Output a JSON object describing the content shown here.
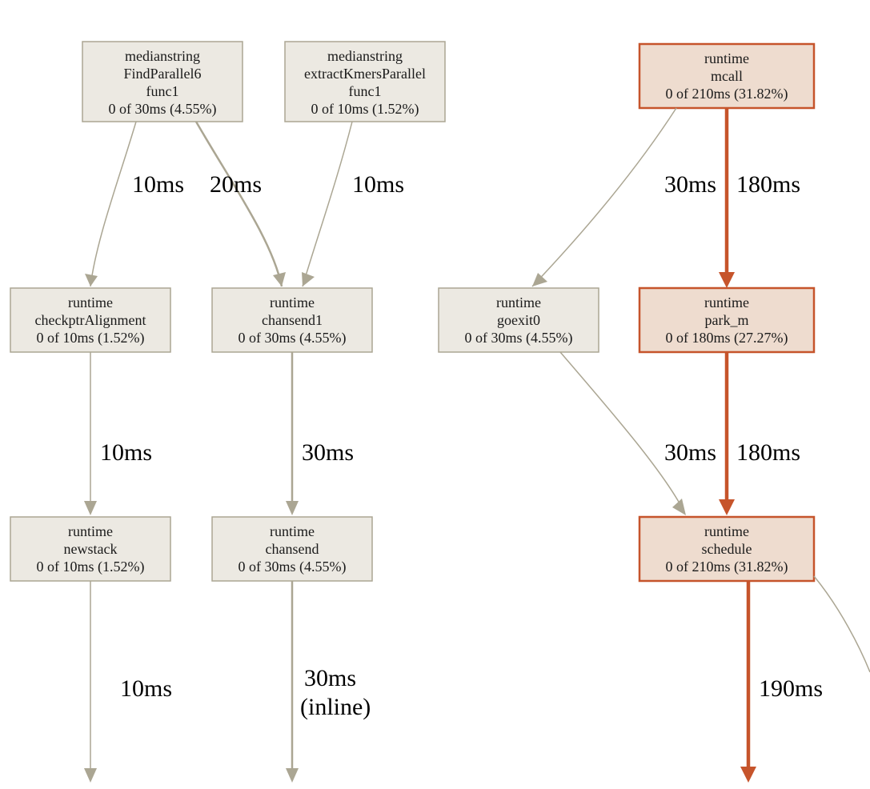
{
  "nodes": {
    "n0": {
      "l1": "medianstring",
      "l2": "FindParallel6",
      "l3": "func1",
      "l4": "0 of 30ms (4.55%)"
    },
    "n1": {
      "l1": "medianstring",
      "l2": "extractKmersParallel",
      "l3": "func1",
      "l4": "0 of 10ms (1.52%)"
    },
    "n2": {
      "l1": "runtime",
      "l2": "mcall",
      "l3": "0 of 210ms (31.82%)"
    },
    "n3": {
      "l1": "runtime",
      "l2": "checkptrAlignment",
      "l3": "0 of 10ms (1.52%)"
    },
    "n4": {
      "l1": "runtime",
      "l2": "chansend1",
      "l3": "0 of 30ms (4.55%)"
    },
    "n5": {
      "l1": "runtime",
      "l2": "goexit0",
      "l3": "0 of 30ms (4.55%)"
    },
    "n6": {
      "l1": "runtime",
      "l2": "park_m",
      "l3": "0 of 180ms (27.27%)"
    },
    "n7": {
      "l1": "runtime",
      "l2": "newstack",
      "l3": "0 of 10ms (1.52%)"
    },
    "n8": {
      "l1": "runtime",
      "l2": "chansend",
      "l3": "0 of 30ms (4.55%)"
    },
    "n9": {
      "l1": "runtime",
      "l2": "schedule",
      "l3": "0 of 210ms (31.82%)"
    }
  },
  "edges": {
    "e0": "10ms",
    "e1": "20ms",
    "e2": "10ms",
    "e3": "30ms",
    "e4": "180ms",
    "e5": "10ms",
    "e6": "30ms",
    "e7": "30ms",
    "e8": "180ms",
    "e9": "10ms",
    "e10a": "30ms",
    "e10b": "(inline)",
    "e11": "190ms"
  }
}
